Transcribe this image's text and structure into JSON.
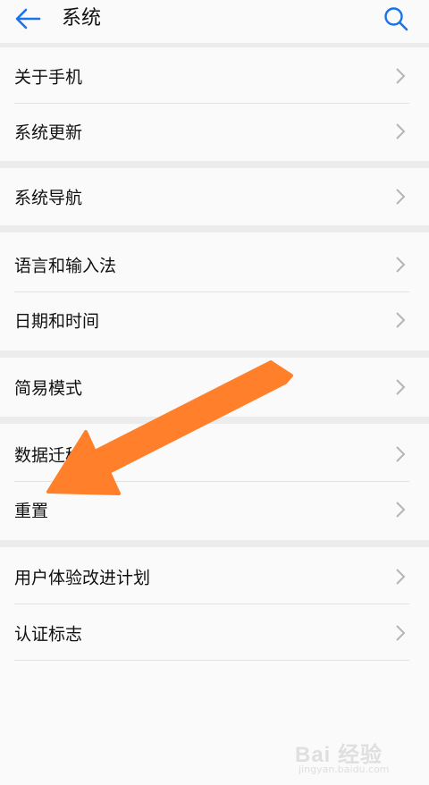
{
  "header": {
    "back_icon": "back-arrow-icon",
    "title": "系统",
    "search_icon": "search-icon",
    "accent_color": "#1a73e8"
  },
  "groups": [
    {
      "items": [
        {
          "label": "关于手机"
        },
        {
          "label": "系统更新"
        }
      ]
    },
    {
      "items": [
        {
          "label": "系统导航"
        }
      ]
    },
    {
      "items": [
        {
          "label": "语言和输入法"
        },
        {
          "label": "日期和时间"
        }
      ]
    },
    {
      "items": [
        {
          "label": "简易模式"
        }
      ]
    },
    {
      "items": [
        {
          "label": "数据迁移"
        },
        {
          "label": "重置"
        }
      ]
    },
    {
      "items": [
        {
          "label": "用户体验改进计划"
        },
        {
          "label": "认证标志"
        }
      ]
    }
  ],
  "row_chevron_icon": "chevron-right-icon",
  "annotation": {
    "type": "arrow",
    "color": "#ff7f2a",
    "points_to": "重置"
  },
  "watermark": {
    "brand": "Bai 经验",
    "site": "jingyan.baidu.com"
  }
}
